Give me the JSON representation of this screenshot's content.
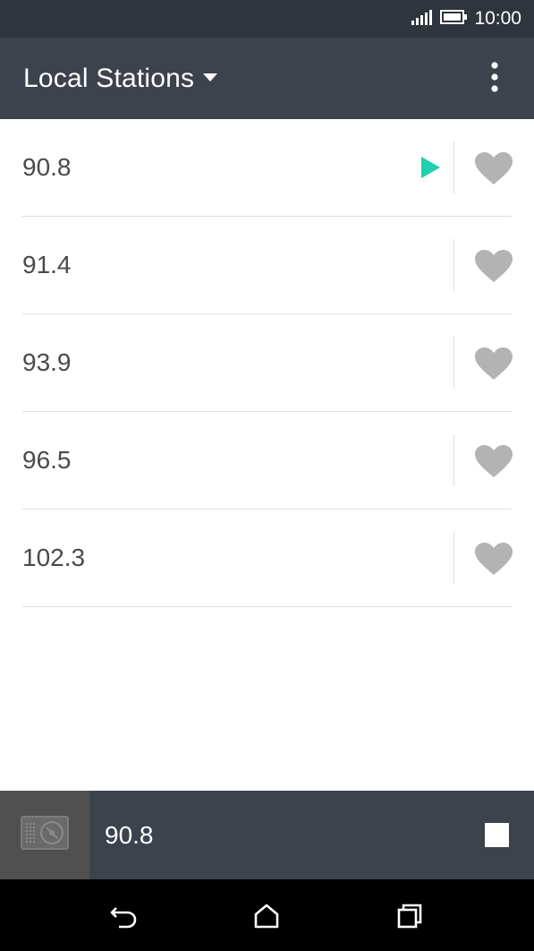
{
  "status_bar": {
    "time": "10:00",
    "signal_icon": "signal-bars-icon",
    "battery_icon": "battery-icon"
  },
  "app_bar": {
    "title": "Local Stations",
    "dropdown_icon": "caret-down-icon",
    "menu_icon": "overflow-menu-icon"
  },
  "stations": [
    {
      "frequency": "90.8",
      "playing": true,
      "favorite": false
    },
    {
      "frequency": "91.4",
      "playing": false,
      "favorite": false
    },
    {
      "frequency": "93.9",
      "playing": false,
      "favorite": false
    },
    {
      "frequency": "96.5",
      "playing": false,
      "favorite": false
    },
    {
      "frequency": "102.3",
      "playing": false,
      "favorite": false
    }
  ],
  "now_playing": {
    "frequency": "90.8",
    "thumbnail_icon": "radio-icon",
    "stop_icon": "stop-icon"
  },
  "nav_bar": {
    "back_icon": "back-icon",
    "home_icon": "home-icon",
    "recents_icon": "recents-icon"
  },
  "colors": {
    "status_bar": "#2f353d",
    "app_bar": "#3d434d",
    "play_accent": "#1fcfb0",
    "heart": "#b3b3b3",
    "now_playing_thumb": "#505050"
  }
}
